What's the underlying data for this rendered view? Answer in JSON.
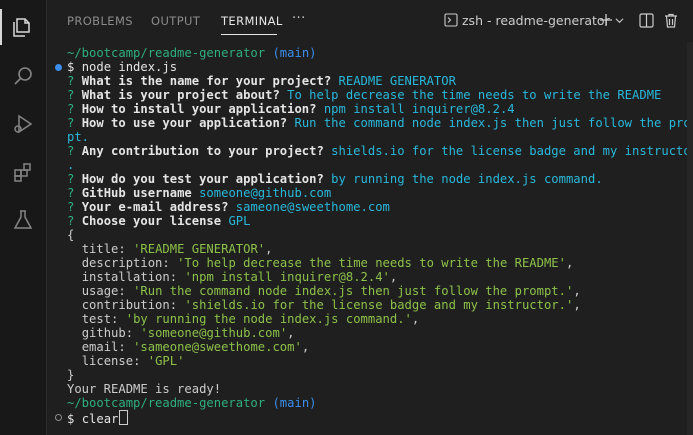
{
  "panel": {
    "tabs": [
      {
        "label": "PROBLEMS"
      },
      {
        "label": "OUTPUT"
      },
      {
        "label": "TERMINAL"
      }
    ],
    "more": "···",
    "terminal_name": "zsh - readme-generator"
  },
  "terminal": {
    "path": "~/bootcamp/readme-generator",
    "branch": "(main)",
    "prompt": "$",
    "command": "node index.js",
    "questions": [
      {
        "q": "What is the name for your project?",
        "a": "README GENERATOR"
      },
      {
        "q": "What is your project about?",
        "a": "To help decrease the time needs to write the README"
      },
      {
        "q": "How to install your application?",
        "a": "npm install inquirer@8.2.4"
      },
      {
        "q": "How to use your application?",
        "a": "Run the command node index.js then just follow the prom",
        "a2": "pt."
      },
      {
        "q": "Any contribution to your project?",
        "a": "shields.io for the license badge and my instructor",
        "a2": "."
      },
      {
        "q": "How do you test your application?",
        "a": "by running the node index.js command."
      },
      {
        "q": "GitHub username",
        "a": "someone@github.com"
      },
      {
        "q": "Your e-mail address?",
        "a": "sameone@sweethome.com"
      },
      {
        "q": "Choose your license",
        "a": "GPL"
      }
    ],
    "object_open": "{",
    "object_fields": [
      {
        "key": "title",
        "value": "'README GENERATOR'"
      },
      {
        "key": "description",
        "value": "'To help decrease the time needs to write the README'"
      },
      {
        "key": "installation",
        "value": "'npm install inquirer@8.2.4'"
      },
      {
        "key": "usage",
        "value": "'Run the command node index.js then just follow the prompt.'"
      },
      {
        "key": "contribution",
        "value": "'shields.io for the license badge and my instructor.'"
      },
      {
        "key": "test",
        "value": "'by running the node index.js command.'"
      },
      {
        "key": "github",
        "value": "'someone@github.com'"
      },
      {
        "key": "email",
        "value": "'sameone@sweethome.com'"
      },
      {
        "key": "license",
        "value": "'GPL'"
      }
    ],
    "object_close": "}",
    "ready_message": "Your README is ready!",
    "current_input": "clear",
    "question_mark": "?"
  },
  "colors": {
    "background": "#1f1f1f",
    "prompt_green": "#2fae7f",
    "branch_blue": "#3b8eea",
    "answer_cyan": "#29b8db",
    "string_green": "#8dc149",
    "success_dot": "#3b8eea"
  }
}
